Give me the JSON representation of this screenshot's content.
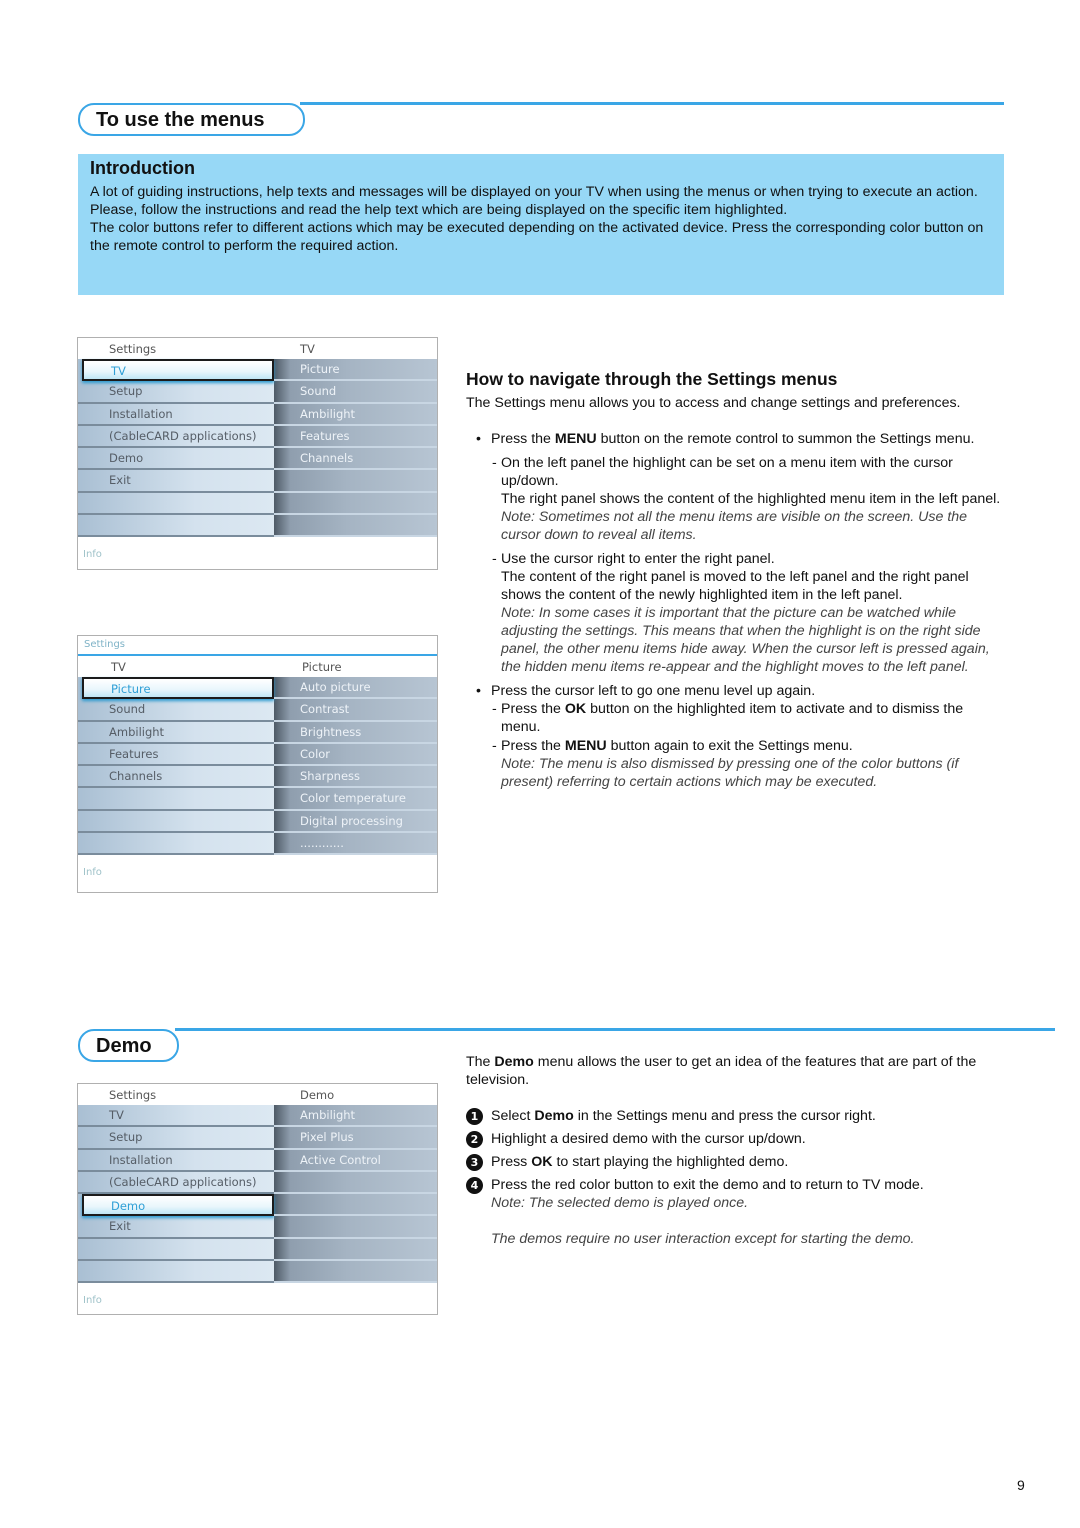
{
  "section1": {
    "title": "To use the menus",
    "intro": {
      "heading": "Introduction",
      "paragraphs": [
        "A lot of guiding instructions, help texts and messages will be displayed on your TV when using the menus or when trying to execute an action.",
        "Please, follow the instructions and read the help text which are being displayed on the specific item highlighted.",
        "The color buttons refer to different actions which may be executed depending on the activated device. Press the corresponding color button on the remote control to perform the required action."
      ]
    }
  },
  "menu1": {
    "left_header": "Settings",
    "right_header": "TV",
    "left_items": [
      "TV",
      "Setup",
      "Installation",
      "(CableCARD applications)",
      "Demo",
      "Exit",
      "",
      ""
    ],
    "selected_index": 0,
    "right_items": [
      "Picture",
      "Sound",
      "Ambilight",
      "Features",
      "Channels",
      "",
      "",
      ""
    ],
    "info": "Info"
  },
  "menu2": {
    "crumb": "Settings",
    "left_header": "TV",
    "right_header": "Picture",
    "left_items": [
      "Picture",
      "Sound",
      "Ambilight",
      "Features",
      "Channels",
      "",
      "",
      ""
    ],
    "selected_index": 0,
    "right_items": [
      "Auto picture",
      "Contrast",
      "Brightness",
      "Color",
      "Sharpness",
      "Color temperature",
      "Digital processing",
      "............"
    ],
    "info": "Info"
  },
  "menu3": {
    "left_header": "Settings",
    "right_header": "Demo",
    "left_items": [
      "TV",
      "Setup",
      "Installation",
      "(CableCARD applications)",
      "Demo",
      "Exit",
      "",
      ""
    ],
    "selected_index": 4,
    "right_items": [
      "Ambilight",
      "Pixel Plus",
      "Active Control",
      "",
      "",
      "",
      "",
      ""
    ],
    "info": "Info"
  },
  "navigate": {
    "heading": "How to navigate through the Settings menus",
    "lead": "The Settings menu allows you to access and change settings and preferences.",
    "b1_pre": "Press the ",
    "b1_bold": "MENU",
    "b1_post": " button on the remote control to summon the Settings menu.",
    "d1_line1": "On the left panel the highlight can be set on a menu item with the cursor up/down.",
    "d1_line2": "The right panel shows the content of the highlighted menu item in the left panel.",
    "d1_note": "Note: Sometimes not all the menu items are visible on the screen. Use the cursor down to reveal all items.",
    "d2_line1": "Use the cursor right to enter the right panel.",
    "d2_line2": "The content of the right panel is moved to the left panel and the right panel shows the content of the newly highlighted item in the left panel.",
    "d2_note": "Note: In some cases it is important that the picture can be watched while adjusting the settings. This means that when the highlight is on the right side panel, the other menu items hide away. When the cursor left is pressed again, the hidden menu items re-appear and the highlight moves to the left panel.",
    "b2": "Press the cursor left to go one menu level up again.",
    "d3_pre": "Press the ",
    "d3_bold": "OK",
    "d3_post": " button on the highlighted item to activate and to dismiss the menu.",
    "d4_pre": "Press the ",
    "d4_bold": "MENU",
    "d4_post": " button again to exit the Settings menu.",
    "d4_note": "Note: The menu is also dismissed by pressing one of the color buttons (if present) referring to certain actions which may be executed.",
    "dash": "-"
  },
  "demo": {
    "title": "Demo",
    "lead_pre": "The ",
    "lead_bold": "Demo",
    "lead_post": " menu allows the user to get an idea of the features that are part of the television.",
    "steps": [
      {
        "num": "1",
        "pre": "Select ",
        "bold": "Demo",
        "post": " in the Settings menu and press the cursor right."
      },
      {
        "num": "2",
        "pre": "Highlight a desired demo with the cursor up/down.",
        "bold": "",
        "post": ""
      },
      {
        "num": "3",
        "pre": "Press ",
        "bold": "OK",
        "post": " to start playing the highlighted demo."
      },
      {
        "num": "4",
        "pre": "Press the red color button to exit the demo and to return to TV mode.",
        "bold": "",
        "post": ""
      }
    ],
    "note": "Note: The selected demo is played once.",
    "footer_note": "The demos require no user interaction except for starting the demo."
  },
  "page_number": "9",
  "colors": {
    "accent": "#3aa6e6",
    "intro_bg": "#97d8f6",
    "highlight_text": "#2f9fd6"
  }
}
